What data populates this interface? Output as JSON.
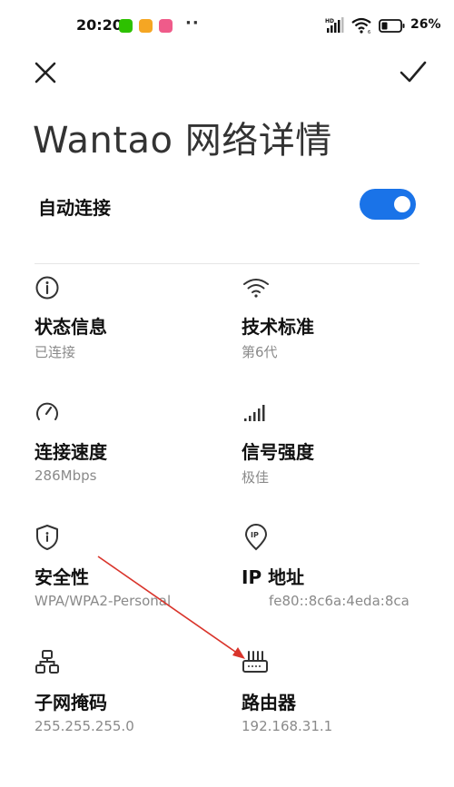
{
  "status_bar": {
    "time": "20:20",
    "battery": "26%",
    "overflow_dots": "··"
  },
  "header": {
    "title": "Wantao 网络详情"
  },
  "auto_connect": {
    "label": "自动连接",
    "enabled": true
  },
  "details": {
    "status": {
      "label": "状态信息",
      "value": "已连接"
    },
    "standard": {
      "label": "技术标准",
      "value": "第6代"
    },
    "speed": {
      "label": "连接速度",
      "value": "286Mbps"
    },
    "signal": {
      "label": "信号强度",
      "value": "极佳"
    },
    "security": {
      "label": "安全性",
      "value": "WPA/WPA2-Personal"
    },
    "ip": {
      "label": "IP 地址",
      "value": "fe80::8c6a:4eda:8ca"
    },
    "subnet": {
      "label": "子网掩码",
      "value": "255.255.255.0"
    },
    "router": {
      "label": "路由器",
      "value": "192.168.31.1"
    }
  },
  "colors": {
    "accent": "#1a73e8",
    "annotation_arrow": "#d9342b"
  }
}
